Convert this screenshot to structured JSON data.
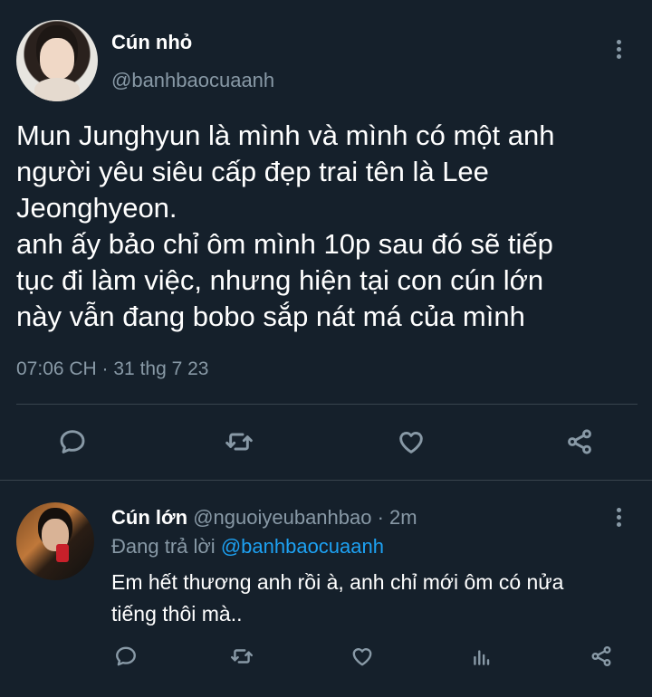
{
  "main_tweet": {
    "display_name": "Cún nhỏ",
    "handle": "@banhbaocuaanh",
    "text_lines": [
      "Mun Junghyun là mình và mình có một anh",
      "người yêu siêu cấp đẹp trai tên là Lee",
      "Jeonghyeon.",
      "anh ấy bảo chỉ ôm mình 10p sau đó sẽ tiếp",
      "tục đi làm việc, nhưng hiện tại con cún lớn",
      "này vẫn đang bobo sắp nát má của mình"
    ],
    "timestamp": "07:06 CH · 31 thg 7 23",
    "actions": [
      "reply-icon",
      "retweet-icon",
      "like-icon",
      "share-icon"
    ]
  },
  "reply_tweet": {
    "display_name": "Cún lớn",
    "handle": "@nguoiyeubanhbao",
    "separator": " · ",
    "time_ago": "2m",
    "replying_prefix": "Đang trả lời",
    "replying_to": "@banhbaocuaanh",
    "text_lines": [
      "Em hết thương anh rồi à, anh chỉ mới ôm có nửa",
      "tiếng thôi mà.."
    ],
    "actions": [
      "reply-icon",
      "retweet-icon",
      "like-icon",
      "stats-icon",
      "share-icon"
    ]
  },
  "colors": {
    "background": "#15202b",
    "text": "#ffffff",
    "secondary": "#8899a6",
    "link": "#1da1f2",
    "divider": "#38444d"
  }
}
